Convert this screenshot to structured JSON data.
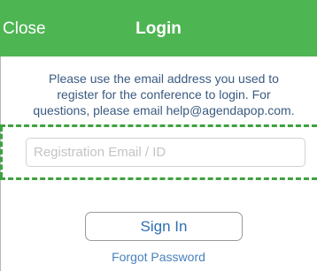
{
  "header": {
    "close_label": "Close",
    "title": "Login"
  },
  "instructions": {
    "line1": "Please use the email address you used to",
    "line2": "register for the conference to login. For",
    "line3": "questions, please email help@agendapop.com."
  },
  "login_form": {
    "email_placeholder": "Registration Email / ID",
    "email_value": "",
    "signin_label": "Sign In",
    "forgot_password_label": "Forgot Password"
  },
  "colors": {
    "header_background": "#4eb553",
    "highlight_dash": "#3ea23e",
    "link_blue": "#2f6fb0"
  }
}
